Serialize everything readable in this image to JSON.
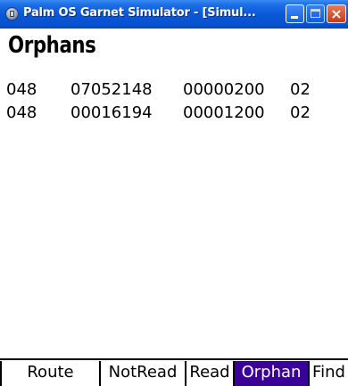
{
  "window": {
    "title": "Palm OS Garnet Simulator - [Simul...",
    "buttons": {
      "minimize": "minimize",
      "maximize": "maximize",
      "close": "×"
    }
  },
  "form": {
    "title": "Orphans"
  },
  "rows": [
    [
      "048",
      "07052148",
      "00000200",
      "02"
    ],
    [
      "048",
      "00016194",
      "00001200",
      "02"
    ]
  ],
  "menu": {
    "items": [
      "Route",
      "NotRead",
      "Read",
      "Orphan",
      "Find"
    ],
    "selected": "Orphan"
  },
  "colors": {
    "titlebar": "#0a58d8",
    "selected": "#3b0098"
  }
}
